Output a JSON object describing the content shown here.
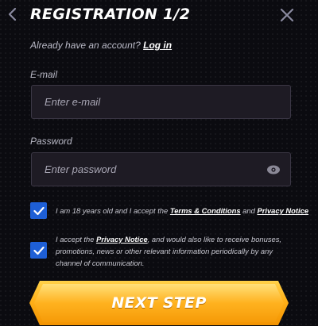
{
  "header": {
    "title": "REGISTRATION 1/2",
    "back_icon": "chevron-left-icon",
    "close_icon": "close-icon"
  },
  "login": {
    "prompt": "Already have an account?",
    "link": "Log in"
  },
  "email": {
    "label": "E-mail",
    "placeholder": "Enter e-mail",
    "value": ""
  },
  "password": {
    "label": "Password",
    "placeholder": "Enter password",
    "value": "",
    "toggle_icon": "eye-icon"
  },
  "consent_age": {
    "checked": true,
    "text_before": "I am 18 years old and I accept the",
    "terms_link": "Terms & Conditions",
    "text_middle": "and",
    "privacy_link": "Privacy Notice"
  },
  "consent_marketing": {
    "checked": true,
    "text_before": "I accept the",
    "privacy_link": "Privacy Notice",
    "text_after": ", and would also like to receive bonuses, promotions, news or other relevant information periodically by any channel of communication."
  },
  "actions": {
    "next_label": "NEXT STEP"
  },
  "colors": {
    "accent_blue": "#1e5fd6",
    "button_orange": "#ffb019",
    "background": "#0b0b10"
  }
}
